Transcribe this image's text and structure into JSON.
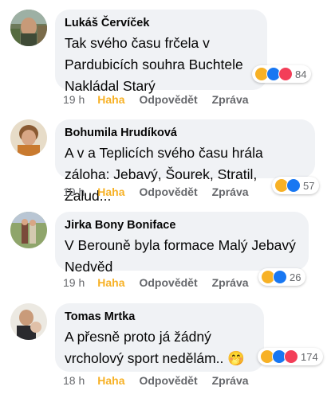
{
  "comments": [
    {
      "author": "Lukáš Červíček",
      "lines": [
        "Tak svého času frčela v",
        "Pardubicích souhra Buchtele",
        "Nakládal Starý"
      ],
      "time": "19 h",
      "reaction_label": "Haha",
      "reply_label": "Odpovědět",
      "message_label": "Zpráva",
      "reaction_count": "84",
      "reaction_icons": [
        "haha-icon",
        "like-icon",
        "love-icon"
      ]
    },
    {
      "author": "Bohumila Hrudíková",
      "lines": [
        "A v a Teplicích svého času hrála",
        "záloha: Jebavý, Šourek, Stratil, Žalud..."
      ],
      "time": "19 h",
      "reaction_label": "Haha",
      "reply_label": "Odpovědět",
      "message_label": "Zpráva",
      "reaction_count": "57",
      "reaction_icons": [
        "haha-icon",
        "like-icon"
      ]
    },
    {
      "author": "Jirka Bony Boniface",
      "lines": [
        "V Berouně byla formace Malý Jebavý",
        "Nedvěd"
      ],
      "time": "19 h",
      "reaction_label": "Haha",
      "reply_label": "Odpovědět",
      "message_label": "Zpráva",
      "reaction_count": "26",
      "reaction_icons": [
        "haha-icon",
        "like-icon"
      ]
    },
    {
      "author": "Tomas Mrtka",
      "lines": [
        "A přesně proto já žádný",
        "vrcholový sport nedělám.. 🤭"
      ],
      "time": "18 h",
      "reaction_label": "Haha",
      "reply_label": "Odpovědět",
      "message_label": "Zpráva",
      "reaction_count": "174",
      "reaction_icons": [
        "haha-icon",
        "like-icon",
        "love-icon"
      ]
    }
  ],
  "colors": {
    "bubble": "#f0f2f5",
    "haha_active": "#f7b125",
    "meta_text": "#65676b",
    "like_blue": "#1877f2",
    "love_red": "#f33e58"
  }
}
